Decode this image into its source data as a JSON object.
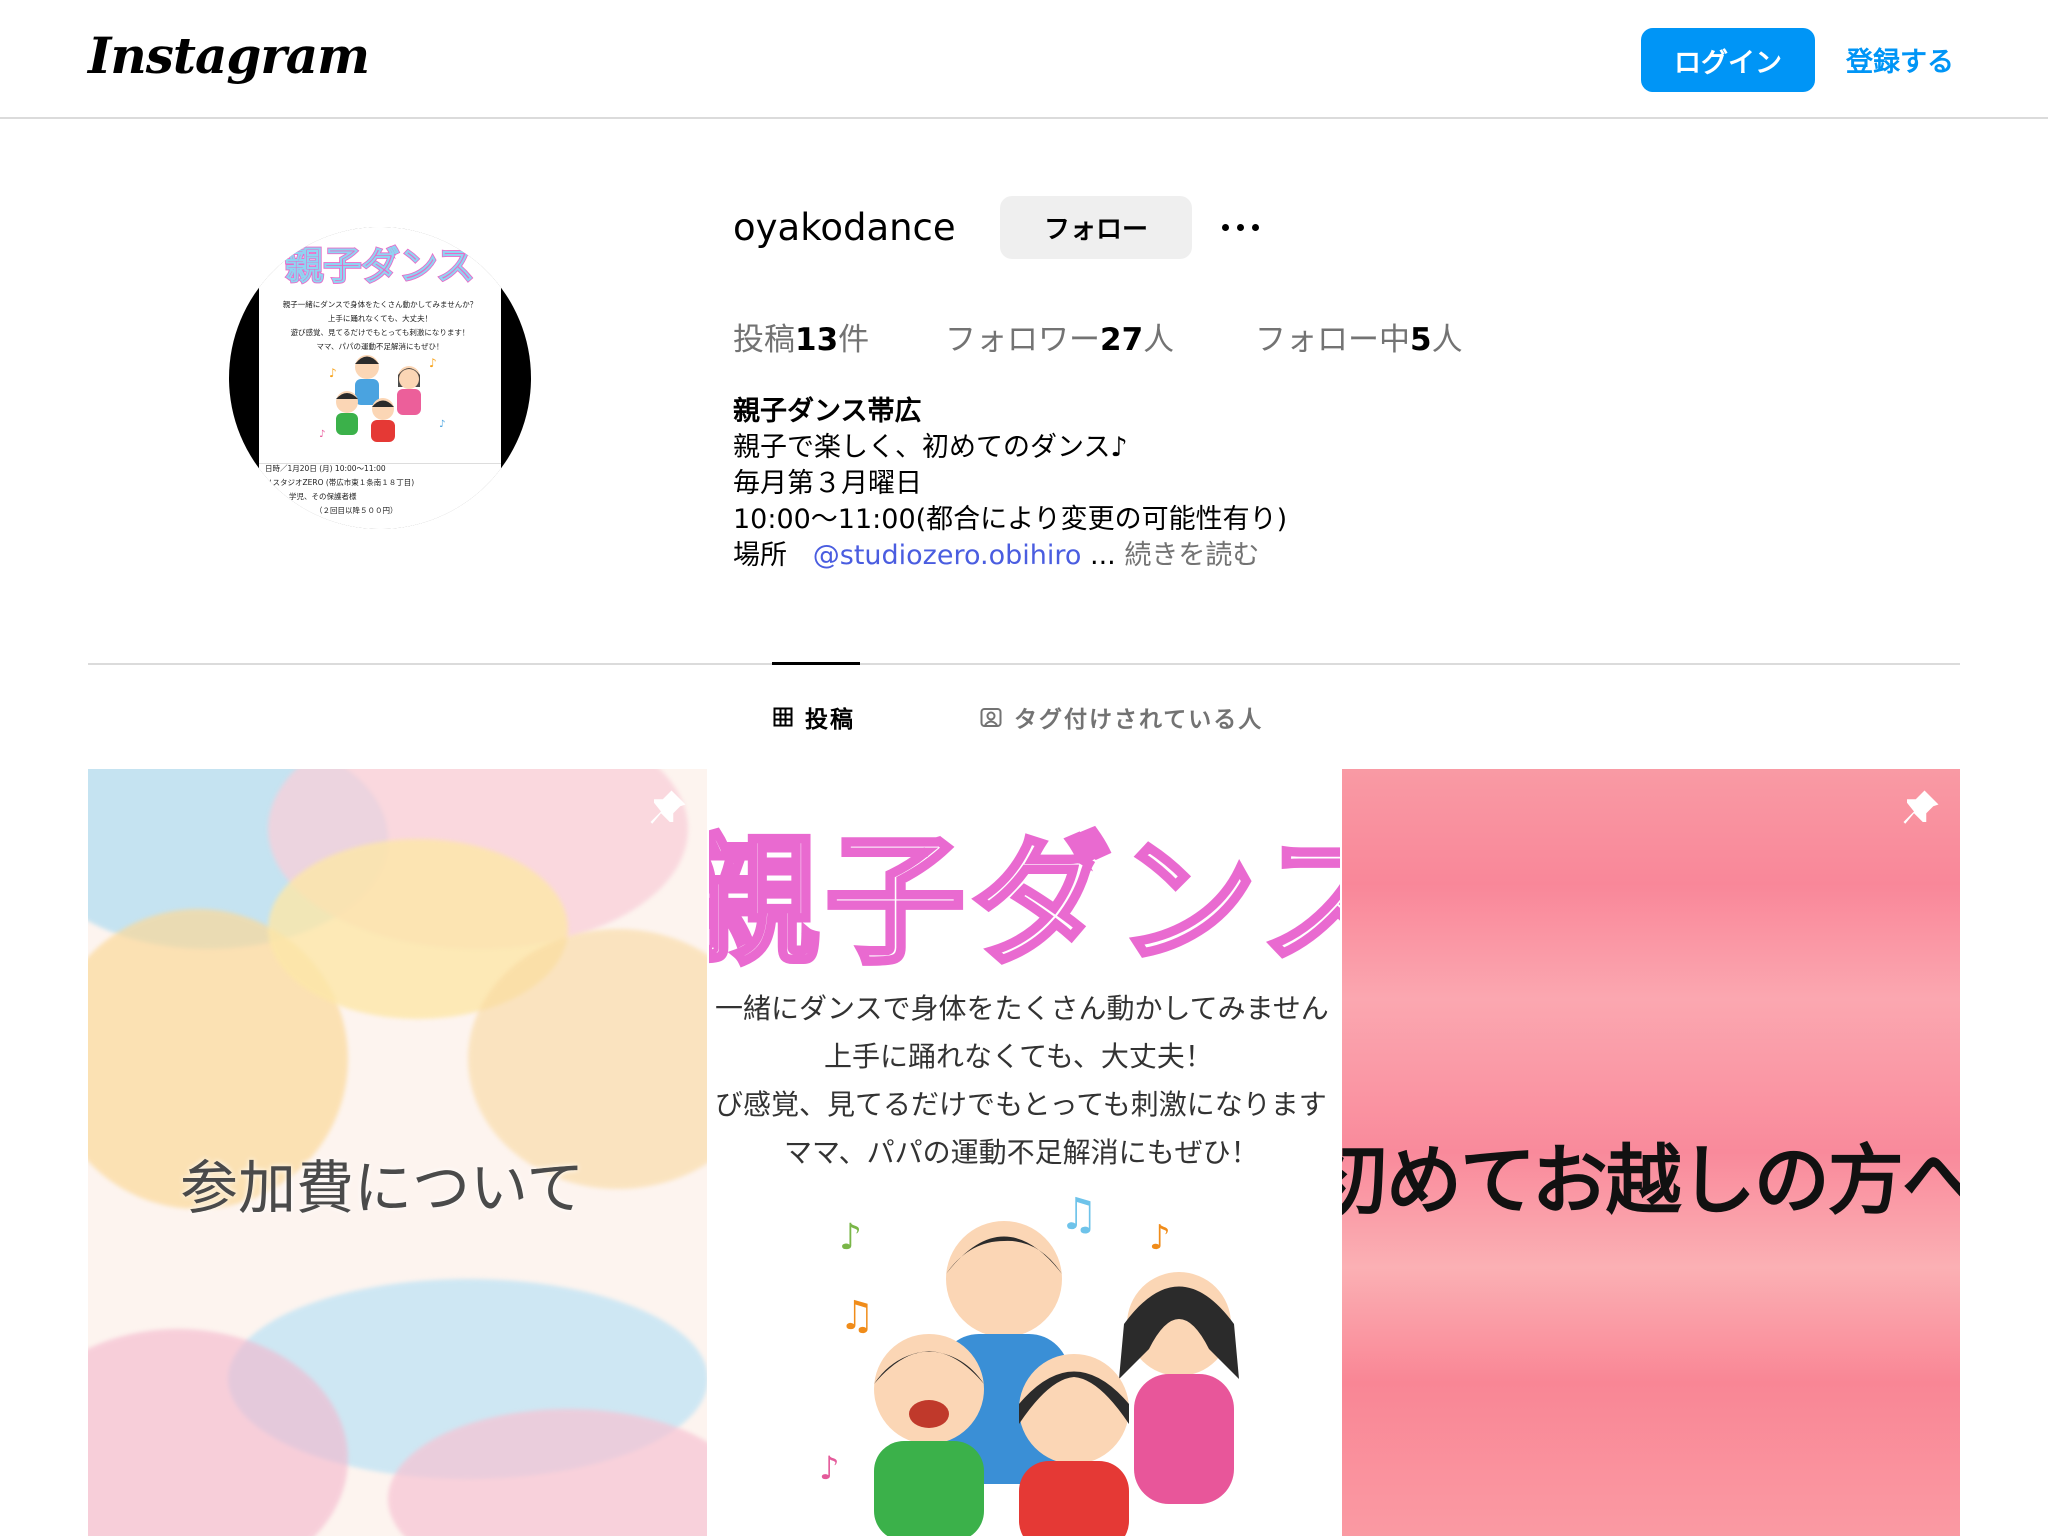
{
  "header": {
    "logo": "Instagram",
    "login_label": "ログイン",
    "signup_label": "登録する"
  },
  "profile": {
    "username": "oyakodance",
    "follow_label": "フォロー",
    "stats": {
      "posts_prefix": "投稿",
      "posts_count": "13",
      "posts_suffix": "件",
      "followers_prefix": "フォロワー",
      "followers_count": "27",
      "followers_suffix": "人",
      "following_prefix": "フォロー中",
      "following_count": "5",
      "following_suffix": "人"
    },
    "bio": {
      "name": "親子ダンス帯広",
      "line1": "親子で楽しく、初めてのダンス♪",
      "line2": "毎月第３月曜日",
      "line3": "10:00〜11:00(都合により変更の可能性有り)",
      "place_label": "場所",
      "mention": "@studiozero.obihiro",
      "ellipsis": "...",
      "more_label": "続きを読む"
    }
  },
  "avatar": {
    "title": "親子ダンス",
    "line1": "親子一緒にダンスで身体をたくさん動かしてみませんか？",
    "line2": "上手に踊れなくても、大丈夫！",
    "line3": "遊び感覚、見てるだけでもとっても刺激になります！",
    "line4": "ママ、パパの運動不足解消にもぜひ！",
    "line5": "日時／1月20日 (月) 10:00〜11:00",
    "line6": "ノスタジオZERO (帯広市東１条南１８丁目)",
    "line7": "学児、その保護者様",
    "line8": "（２回目以降５００円）"
  },
  "tabs": [
    {
      "label": "投稿",
      "icon": "grid-icon",
      "active": true
    },
    {
      "label": "タグ付けされている人",
      "icon": "tagged-person-icon",
      "active": false
    }
  ],
  "posts": [
    {
      "text": "参加費について",
      "pinned": true
    },
    {
      "title": "親子ダンス",
      "line1": "一緒にダンスで身体をたくさん動かしてみません",
      "line2": "上手に踊れなくても、大丈夫！",
      "line3": "び感覚、見てるだけでもとっても刺激になります",
      "line4": "ママ、パパの運動不足解消にもぜひ！",
      "pinned": false
    },
    {
      "text": "初めてお越しの方へ",
      "pinned": true
    }
  ],
  "colors": {
    "accent": "#0095f6",
    "mention": "#4a5de0",
    "muted": "#737373",
    "divider": "#dbdbdb"
  }
}
